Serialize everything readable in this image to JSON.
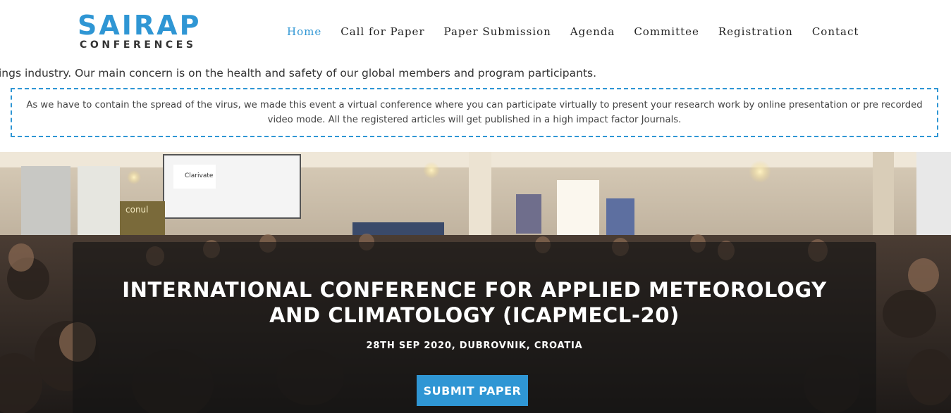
{
  "logo": {
    "main": "SAIRAP",
    "sub": "CONFERENCES"
  },
  "nav": {
    "items": [
      {
        "label": "Home",
        "active": true
      },
      {
        "label": "Call for Paper"
      },
      {
        "label": "Paper Submission"
      },
      {
        "label": "Agenda"
      },
      {
        "label": "Committee"
      },
      {
        "label": "Registration"
      },
      {
        "label": "Contact"
      }
    ]
  },
  "ticker": {
    "text": "ings industry. Our main concern is on the health and safety of our global members and program participants."
  },
  "notice": {
    "text": "As we have to contain the spread of the virus, we made this event a virtual conference where you can participate virtually to present your research work by online presentation or pre recorded video mode. All the registered articles will get published in a high impact factor Journals."
  },
  "hero": {
    "title_line1": "INTERNATIONAL CONFERENCE FOR APPLIED METEOROLOGY",
    "title_line2": "AND CLIMATOLOGY (ICAPMECL-20)",
    "date": "28TH SEP 2020, DUBROVNIK, CROATIA",
    "button": "SUBMIT PAPER",
    "banner_text": "conul",
    "screen_text": "Clarivate"
  },
  "colors": {
    "accent": "#2f96d4",
    "text": "#333333"
  }
}
